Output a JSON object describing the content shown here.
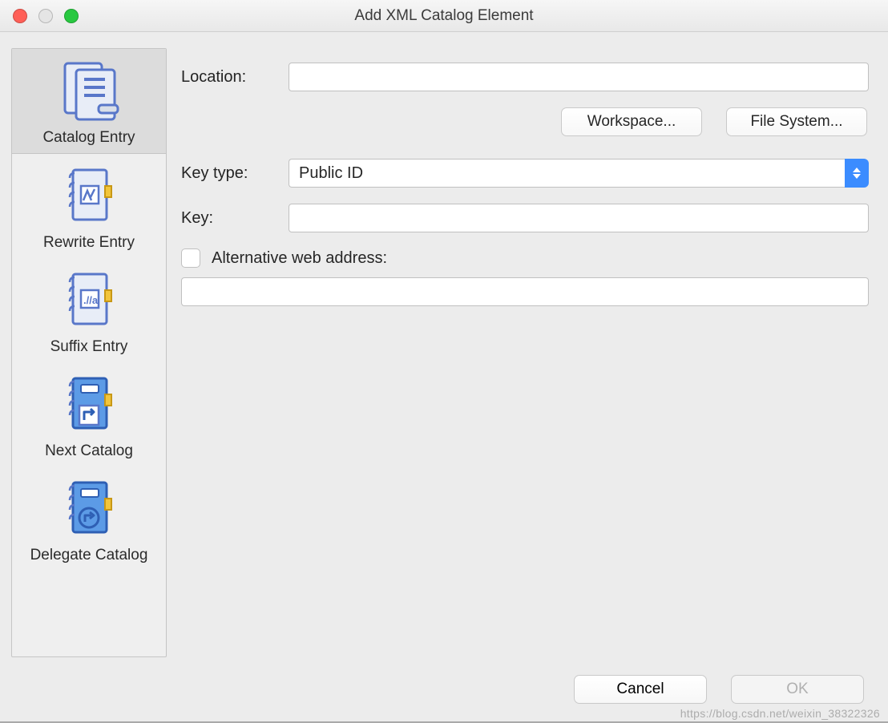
{
  "window": {
    "title": "Add XML Catalog Element"
  },
  "sidebar": {
    "items": [
      {
        "label": "Catalog Entry"
      },
      {
        "label": "Rewrite Entry"
      },
      {
        "label": "Suffix Entry"
      },
      {
        "label": "Next Catalog"
      },
      {
        "label": "Delegate Catalog"
      }
    ]
  },
  "form": {
    "location_label": "Location:",
    "location_value": "",
    "workspace_btn": "Workspace...",
    "filesystem_btn": "File System...",
    "keytype_label": "Key type:",
    "keytype_value": "Public ID",
    "key_label": "Key:",
    "key_value": "",
    "alt_label": "Alternative web address:",
    "alt_value": ""
  },
  "footer": {
    "cancel": "Cancel",
    "ok": "OK",
    "watermark": "https://blog.csdn.net/weixin_38322326"
  }
}
